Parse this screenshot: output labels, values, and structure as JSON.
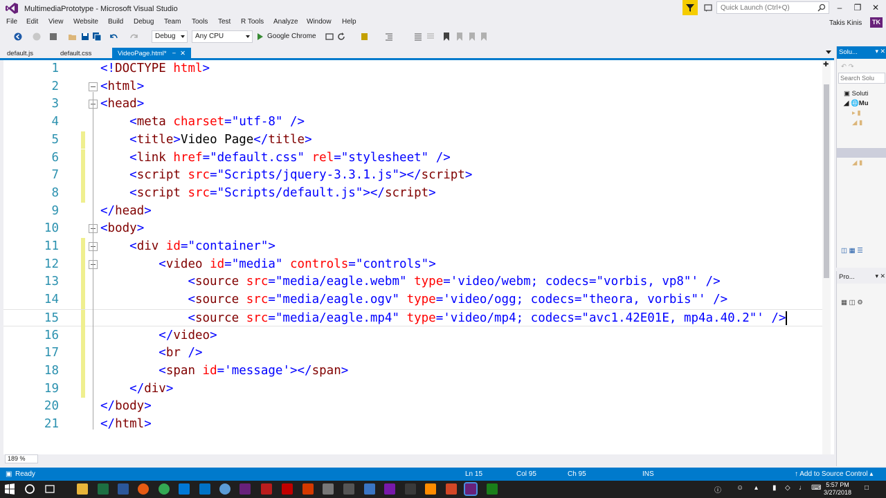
{
  "window": {
    "title": "MultimediaPrototype - Microsoft Visual Studio",
    "quick_launch_placeholder": "Quick Launch (Ctrl+Q)",
    "user_name": "Takis Kinis",
    "user_initials": "TK"
  },
  "menu": [
    "File",
    "Edit",
    "View",
    "Website",
    "Build",
    "Debug",
    "Team",
    "Tools",
    "Test",
    "R Tools",
    "Analyze",
    "Window",
    "Help"
  ],
  "toolbar": {
    "config": "Debug",
    "platform": "Any CPU",
    "run_target": "Google Chrome"
  },
  "tabs": [
    {
      "label": "default.js",
      "active": false
    },
    {
      "label": "default.css",
      "active": false
    },
    {
      "label": "VideoPage.html*",
      "active": true
    }
  ],
  "editor": {
    "lines": [
      {
        "n": "1",
        "html": "<span class=\"b\">&lt;!</span><span class=\"k\">DOCTYPE</span> <span class=\"a\">html</span><span class=\"b\">&gt;</span>"
      },
      {
        "n": "2",
        "html": "<span class=\"b\">&lt;</span><span class=\"k\">html</span><span class=\"b\">&gt;</span>"
      },
      {
        "n": "3",
        "html": "<span class=\"b\">&lt;</span><span class=\"k\">head</span><span class=\"b\">&gt;</span>"
      },
      {
        "n": "4",
        "html": "    <span class=\"b\">&lt;</span><span class=\"k\">meta</span> <span class=\"a\">charset</span><span class=\"b\">=\"utf-8\" /&gt;</span>"
      },
      {
        "n": "5",
        "html": "    <span class=\"b\">&lt;</span><span class=\"k\">title</span><span class=\"b\">&gt;</span><span class=\"t\">Video Page</span><span class=\"b\">&lt;/</span><span class=\"k\">title</span><span class=\"b\">&gt;</span>"
      },
      {
        "n": "6",
        "html": "    <span class=\"b\">&lt;</span><span class=\"k\">link</span> <span class=\"a\">href</span><span class=\"b\">=\"default.css\"</span> <span class=\"a\">rel</span><span class=\"b\">=\"stylesheet\" /&gt;</span>"
      },
      {
        "n": "7",
        "html": "    <span class=\"b\">&lt;</span><span class=\"k\">script</span> <span class=\"a\">src</span><span class=\"b\">=\"Scripts/jquery-3.3.1.js\"&gt;&lt;/</span><span class=\"k\">script</span><span class=\"b\">&gt;</span>"
      },
      {
        "n": "8",
        "html": "    <span class=\"b\">&lt;</span><span class=\"k\">script</span> <span class=\"a\">src</span><span class=\"b\">=\"Scripts/default.js\"&gt;&lt;/</span><span class=\"k\">script</span><span class=\"b\">&gt;</span>"
      },
      {
        "n": "9",
        "html": "<span class=\"b\">&lt;/</span><span class=\"k\">head</span><span class=\"b\">&gt;</span>"
      },
      {
        "n": "10",
        "html": "<span class=\"b\">&lt;</span><span class=\"k\">body</span><span class=\"b\">&gt;</span>"
      },
      {
        "n": "11",
        "html": "    <span class=\"b\">&lt;</span><span class=\"k\">div</span> <span class=\"a\">id</span><span class=\"b\">=\"container\"&gt;</span>"
      },
      {
        "n": "12",
        "html": "        <span class=\"b\">&lt;</span><span class=\"k\">video</span> <span class=\"a\">id</span><span class=\"b\">=\"media\"</span> <span class=\"a\">controls</span><span class=\"b\">=\"controls\"&gt;</span>"
      },
      {
        "n": "13",
        "html": "            <span class=\"b\">&lt;</span><span class=\"k\">source</span> <span class=\"a\">src</span><span class=\"b\">=\"media/eagle.webm\"</span> <span class=\"a\">type</span><span class=\"b\">='video/webm; codecs=\"vorbis, vp8\"' /&gt;</span>"
      },
      {
        "n": "14",
        "html": "            <span class=\"b\">&lt;</span><span class=\"k\">source</span> <span class=\"a\">src</span><span class=\"b\">=\"media/eagle.ogv\"</span> <span class=\"a\">type</span><span class=\"b\">='video/ogg; codecs=\"theora, vorbis\"' /&gt;</span>"
      },
      {
        "n": "15",
        "html": "            <span class=\"b\">&lt;</span><span class=\"k\">source</span> <span class=\"a\">src</span><span class=\"b\">=\"media/eagle.mp4\"</span> <span class=\"a\">type</span><span class=\"b\">='video/mp4; codecs=\"avc1.42E01E, mp4a.40.2\"' /&gt;</span><span class=\"caret\"></span>"
      },
      {
        "n": "16",
        "html": "        <span class=\"b\">&lt;/</span><span class=\"k\">video</span><span class=\"b\">&gt;</span>"
      },
      {
        "n": "17",
        "html": "        <span class=\"b\">&lt;</span><span class=\"k\">br</span> <span class=\"b\">/&gt;</span>"
      },
      {
        "n": "18",
        "html": "        <span class=\"b\">&lt;</span><span class=\"k\">span</span> <span class=\"a\">id</span><span class=\"b\">='message'&gt;&lt;/</span><span class=\"k\">span</span><span class=\"b\">&gt;</span>"
      },
      {
        "n": "19",
        "html": "    <span class=\"b\">&lt;/</span><span class=\"k\">div</span><span class=\"b\">&gt;</span>"
      },
      {
        "n": "20",
        "html": "<span class=\"b\">&lt;/</span><span class=\"k\">body</span><span class=\"b\">&gt;</span>"
      },
      {
        "n": "21",
        "html": "<span class=\"b\">&lt;/</span><span class=\"k\">html</span><span class=\"b\">&gt;</span>"
      }
    ],
    "zoom": "189 %"
  },
  "solution_panel": {
    "title": "Solu...",
    "search_placeholder": "Search Solu",
    "tree": [
      "Soluti",
      "Mu"
    ]
  },
  "properties_panel": {
    "title": "Pro..."
  },
  "status": {
    "state": "Ready",
    "line": "Ln 15",
    "col": "Col 95",
    "ch": "Ch 95",
    "mode": "INS",
    "source_control": "Add to Source Control"
  },
  "clock": {
    "time": "5:57 PM",
    "date": "3/27/2018"
  },
  "colors": {
    "accent": "#007acc",
    "brand": "#68217a",
    "filter": "#f5cc00"
  }
}
